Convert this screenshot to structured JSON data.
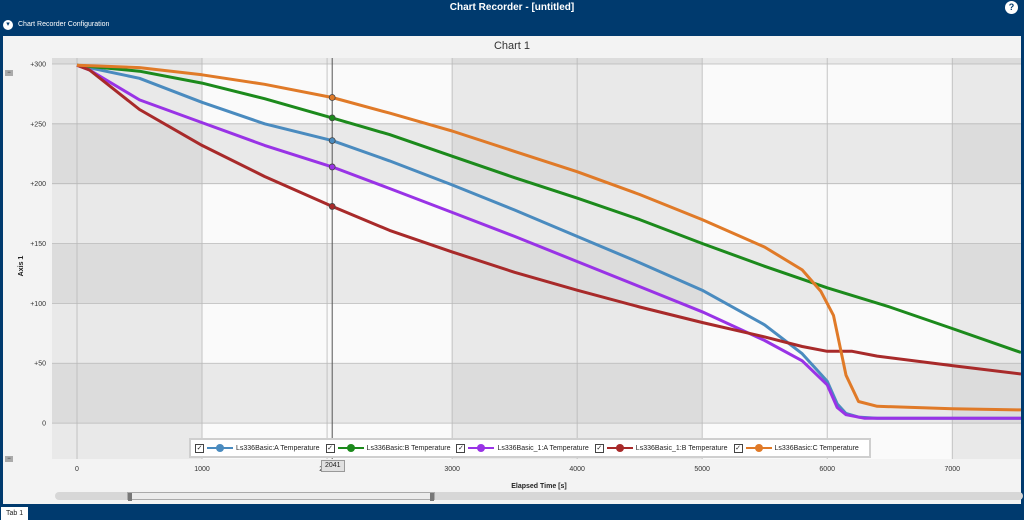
{
  "window": {
    "title": "Chart Recorder - [untitled]",
    "help": "?"
  },
  "subbar": {
    "label": "Chart Recorder Configuration",
    "collapse_glyph": "▾"
  },
  "chart": {
    "title": "Chart 1",
    "cursor_value": "2041"
  },
  "tabs": [
    {
      "label": "Tab 1"
    }
  ],
  "chart_data": {
    "type": "line",
    "title": "Chart 1",
    "xlabel": "Elapsed Time [s]",
    "ylabel": "Axis 1",
    "xlim": [
      -200,
      7550
    ],
    "ylim": [
      -30,
      305
    ],
    "xticks": [
      0,
      1000,
      2000,
      3000,
      4000,
      5000,
      6000,
      7000
    ],
    "yticks": [
      0,
      50,
      100,
      150,
      200,
      250,
      300
    ],
    "ytick_labels": [
      "0",
      "+50",
      "+100",
      "+150",
      "+200",
      "+250",
      "+300"
    ],
    "cursor_x": 2041,
    "legend_position": "bottom",
    "series": [
      {
        "name": "Ls336Basic:A Temperature",
        "color": "#4a8bbf",
        "checked": "✓",
        "x": [
          0,
          500,
          1000,
          1500,
          2041,
          2500,
          3000,
          3500,
          4000,
          4500,
          5000,
          5500,
          5800,
          6000,
          6080,
          6150,
          6250,
          6400,
          7000,
          7550
        ],
        "y": [
          299,
          288,
          268,
          250,
          236,
          219,
          199,
          178,
          156,
          134,
          111,
          82,
          58,
          35,
          16,
          8,
          5,
          4,
          4,
          4
        ]
      },
      {
        "name": "Ls336Basic:B Temperature",
        "color": "#1c8a1c",
        "checked": "✓",
        "x": [
          0,
          500,
          1000,
          1500,
          2041,
          2500,
          3000,
          3500,
          4000,
          4500,
          5000,
          5500,
          6000,
          6500,
          7000,
          7550
        ],
        "y": [
          299,
          294,
          284,
          271,
          255,
          241,
          223,
          205,
          188,
          170,
          150,
          131,
          113,
          97,
          79,
          59
        ]
      },
      {
        "name": "Ls336Basic_1:A Temperature",
        "color": "#9933e6",
        "checked": "✓",
        "x": [
          0,
          100,
          500,
          1000,
          1500,
          2041,
          2500,
          3000,
          3500,
          4000,
          4500,
          5000,
          5500,
          5800,
          6000,
          6080,
          6150,
          6300,
          7000,
          7550
        ],
        "y": [
          299,
          295,
          270,
          251,
          232,
          214,
          196,
          176,
          156,
          135,
          114,
          93,
          69,
          52,
          32,
          13,
          7,
          4,
          4,
          4
        ]
      },
      {
        "name": "Ls336Basic_1:B Temperature",
        "color": "#a82a2a",
        "checked": "✓",
        "x": [
          0,
          100,
          500,
          1000,
          1500,
          2041,
          2500,
          3000,
          3500,
          4000,
          4500,
          5000,
          5500,
          5800,
          6000,
          6200,
          6400,
          7000,
          7550
        ],
        "y": [
          299,
          295,
          262,
          232,
          206,
          181,
          161,
          143,
          126,
          111,
          97,
          84,
          72,
          64,
          60,
          60,
          56,
          48,
          41
        ]
      },
      {
        "name": "Ls336Basic:C Temperature",
        "color": "#e07a28",
        "checked": "✓",
        "x": [
          0,
          500,
          1000,
          1500,
          2041,
          2500,
          3000,
          3500,
          4000,
          4500,
          5000,
          5500,
          5800,
          5950,
          6050,
          6150,
          6250,
          6400,
          7000,
          7550
        ],
        "y": [
          299,
          297,
          291,
          283,
          272,
          259,
          244,
          227,
          210,
          191,
          170,
          147,
          128,
          110,
          90,
          40,
          18,
          14,
          12,
          11
        ]
      }
    ]
  }
}
